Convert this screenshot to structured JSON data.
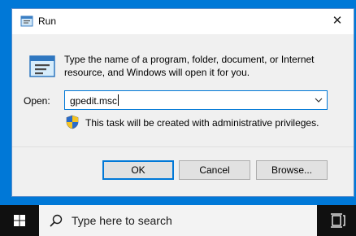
{
  "dialog": {
    "title": "Run",
    "close_glyph": "✕",
    "description": "Type the name of a program, folder, document, or Internet resource, and Windows will open it for you.",
    "open_label": "Open:",
    "open_value": "gpedit.msc",
    "admin_note": "This task will be created with administrative privileges.",
    "buttons": {
      "ok": "OK",
      "cancel": "Cancel",
      "browse": "Browse..."
    },
    "icons": [
      "run-app-icon",
      "uac-shield-icon",
      "chevron-down-icon",
      "close-icon"
    ]
  },
  "taskbar": {
    "search_placeholder": "Type here to search",
    "icons": [
      "windows-start-icon",
      "search-icon",
      "task-view-icon"
    ]
  },
  "colors": {
    "desktop": "#0078d7",
    "accent": "#0078d7",
    "taskbar": "#101010",
    "dialog": "#f0f0f0"
  }
}
